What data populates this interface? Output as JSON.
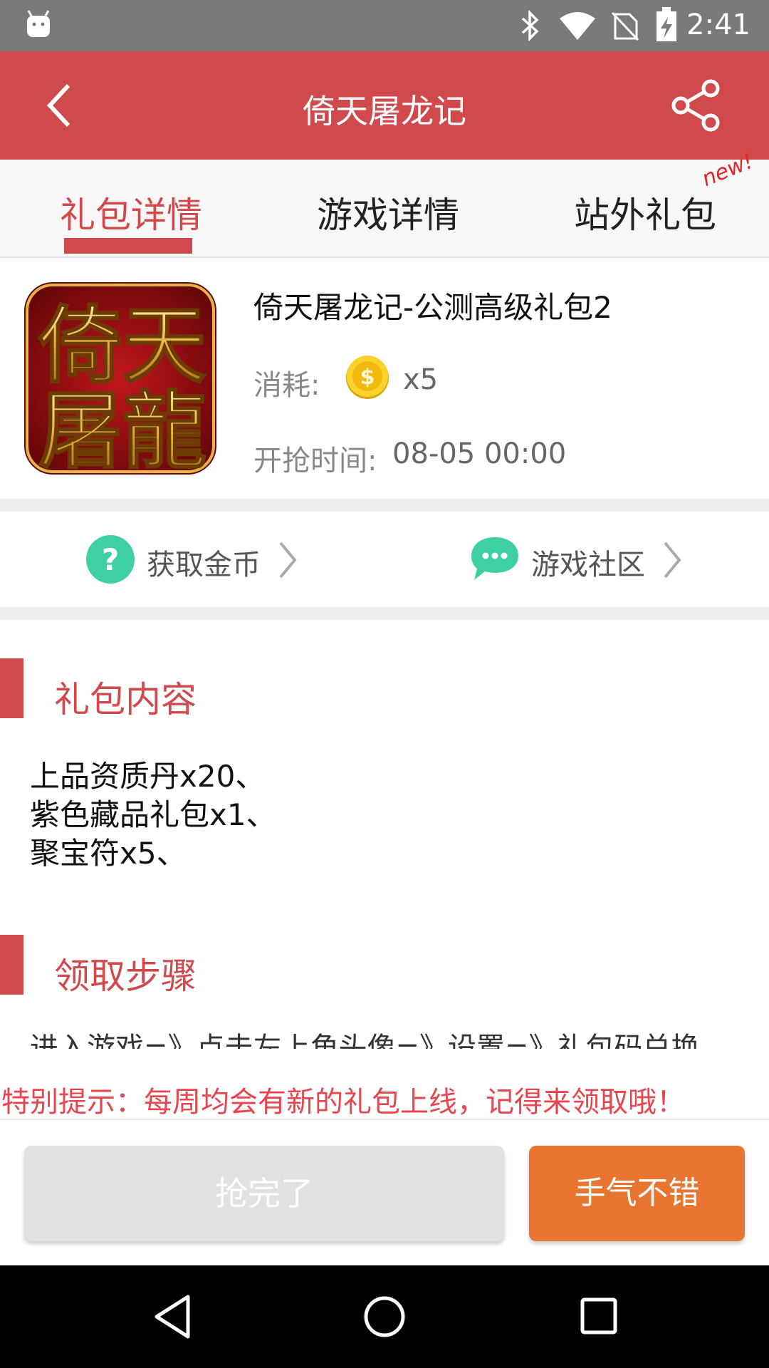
{
  "status_bar": {
    "time": "2:41",
    "icons": [
      "android-icon",
      "bluetooth-icon",
      "wifi-icon",
      "no-sim-icon",
      "battery-charging-icon"
    ],
    "background": "#7a7a7a"
  },
  "app_bar": {
    "title": "倚天屠龙记",
    "color": "#d04a4d",
    "icons": [
      "back-icon",
      "share-icon"
    ]
  },
  "tabs": {
    "items": [
      {
        "label": "礼包详情",
        "active": true
      },
      {
        "label": "游戏详情",
        "active": false
      },
      {
        "label": "站外礼包",
        "active": false
      }
    ],
    "new_badge": "new!"
  },
  "gift": {
    "game_icon_text": "倚天屠龍",
    "title": "倚天屠龙记-公测高级礼包2",
    "cost_label": "消耗:",
    "coin_icon": "gold-coin-icon",
    "cost_value": "x5",
    "start_label": "开抢时间:",
    "start_value": "08-05 00:00"
  },
  "links": {
    "get_coins": "获取金币",
    "community": "游戏社区"
  },
  "sections": {
    "content_title": "礼包内容",
    "content_lines": [
      "上品资质丹x20、",
      "紫色藏品礼包x1、",
      "聚宝符x5、"
    ],
    "steps_title": "领取步骤",
    "steps_text": "进入游戏=》点击左上角头像=》设置=》礼包码兑换"
  },
  "tip": "特别提示：每周均会有新的礼包上线，记得来领取哦！",
  "buttons": {
    "sold_out": "抢完了",
    "luck": "手气不错"
  },
  "colors": {
    "accent": "#d04a4d",
    "orange": "#e87530",
    "teal": "#3ecfa2"
  }
}
